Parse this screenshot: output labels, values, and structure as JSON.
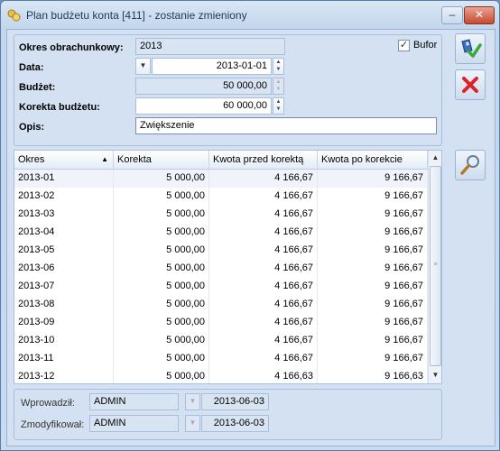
{
  "window": {
    "title": "Plan budżetu konta [411] - zostanie zmieniony",
    "minimize_glyph": "–",
    "close_glyph": "✕"
  },
  "form": {
    "okres_label": "Okres obrachunkowy:",
    "okres_value": "2013",
    "data_label": "Data:",
    "data_value": "2013-01-01",
    "budzet_label": "Budżet:",
    "budzet_value": "50 000,00",
    "korekta_label": "Korekta budżetu:",
    "korekta_value": "60 000,00",
    "opis_label": "Opis:",
    "opis_value": "Zwiększenie",
    "bufor_label": "Bufor",
    "bufor_checked": true
  },
  "grid": {
    "columns": [
      "Okres",
      "Korekta",
      "Kwota przed korektą",
      "Kwota po korekcie"
    ],
    "rows": [
      [
        "2013-01",
        "5 000,00",
        "4 166,67",
        "9 166,67"
      ],
      [
        "2013-02",
        "5 000,00",
        "4 166,67",
        "9 166,67"
      ],
      [
        "2013-03",
        "5 000,00",
        "4 166,67",
        "9 166,67"
      ],
      [
        "2013-04",
        "5 000,00",
        "4 166,67",
        "9 166,67"
      ],
      [
        "2013-05",
        "5 000,00",
        "4 166,67",
        "9 166,67"
      ],
      [
        "2013-06",
        "5 000,00",
        "4 166,67",
        "9 166,67"
      ],
      [
        "2013-07",
        "5 000,00",
        "4 166,67",
        "9 166,67"
      ],
      [
        "2013-08",
        "5 000,00",
        "4 166,67",
        "9 166,67"
      ],
      [
        "2013-09",
        "5 000,00",
        "4 166,67",
        "9 166,67"
      ],
      [
        "2013-10",
        "5 000,00",
        "4 166,67",
        "9 166,67"
      ],
      [
        "2013-11",
        "5 000,00",
        "4 166,67",
        "9 166,67"
      ],
      [
        "2013-12",
        "5 000,00",
        "4 166,63",
        "9 166,63"
      ]
    ]
  },
  "footer": {
    "wprowadzil_label": "Wprowadził:",
    "wprowadzil_user": "ADMIN",
    "wprowadzil_date": "2013-06-03",
    "zmodyfikowal_label": "Zmodyfikował:",
    "zmodyfikowal_user": "ADMIN",
    "zmodyfikowal_date": "2013-06-03"
  },
  "icons": {
    "save": "save-check-icon",
    "cancel": "cancel-x-icon",
    "search": "magnifier-icon"
  },
  "colors": {
    "cancel_red": "#d8242a",
    "save_blue": "#2a5fb8",
    "save_green": "#3aa83a"
  }
}
